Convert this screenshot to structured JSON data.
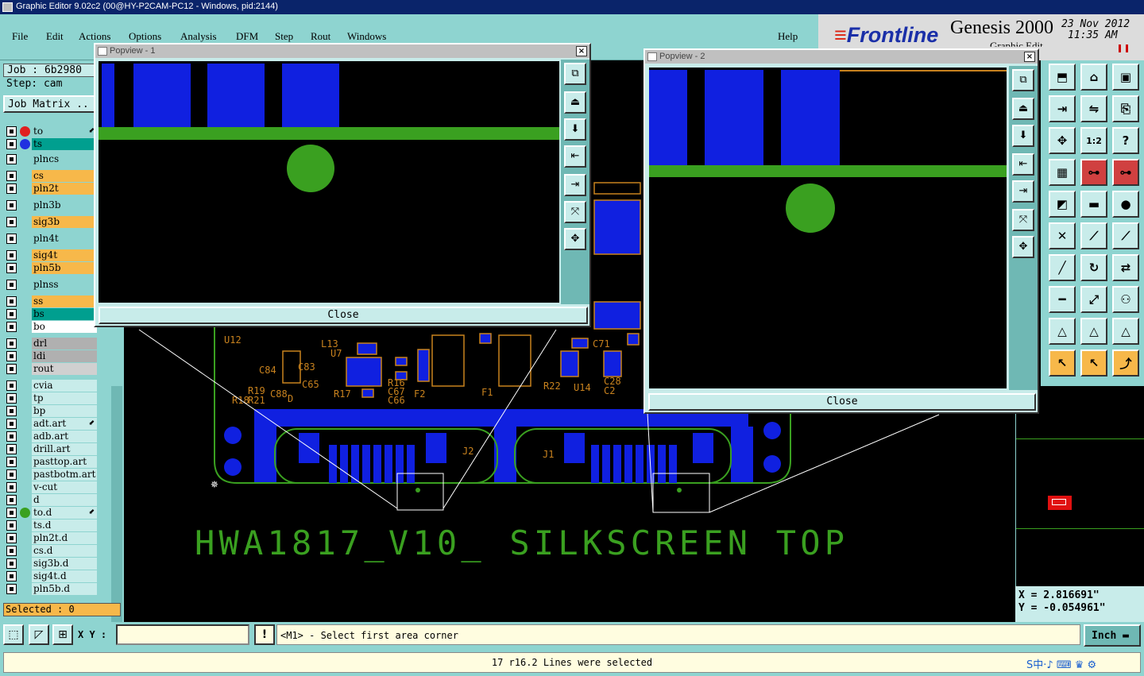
{
  "window": {
    "title": "Graphic Editor 9.02c2 (00@HY-P2CAM-PC12 - Windows, pid:2144)"
  },
  "menu": [
    "File",
    "Edit",
    "Actions",
    "Options",
    "Analysis",
    "DFM",
    "Step",
    "Rout",
    "Windows"
  ],
  "help": "Help",
  "logo": {
    "brand": "Frontline",
    "product": "Genesis 2000",
    "date": "23 Nov 2012",
    "time": "11:35 AM",
    "subtitle": "Graphic Edit"
  },
  "job": {
    "label": "Job : 6b2980",
    "step": "Step: cam",
    "matrix": "Job Matrix .."
  },
  "layers": [
    {
      "name": "to",
      "color": "#8ed4d0",
      "dot": "#e02020",
      "arrow": true
    },
    {
      "name": "ts",
      "color": "#009f8f",
      "dot": "#2030e0",
      "arrow": false
    },
    {
      "name": "plncs",
      "color": "#8ed4d0",
      "dot": "",
      "arrow": false
    },
    {
      "name": "cs",
      "color": "#f7b84a",
      "dot": "",
      "arrow": false
    },
    {
      "name": "pln2t",
      "color": "#f7b84a",
      "dot": "",
      "arrow": false
    },
    {
      "name": "pln3b",
      "color": "#8ed4d0",
      "dot": "",
      "arrow": false
    },
    {
      "name": "sig3b",
      "color": "#f7b84a",
      "dot": "",
      "arrow": false
    },
    {
      "name": "pln4t",
      "color": "#8ed4d0",
      "dot": "",
      "arrow": false
    },
    {
      "name": "sig4t",
      "color": "#f7b84a",
      "dot": "",
      "arrow": false
    },
    {
      "name": "pln5b",
      "color": "#f7b84a",
      "dot": "",
      "arrow": false
    },
    {
      "name": "plnss",
      "color": "#8ed4d0",
      "dot": "",
      "arrow": false
    },
    {
      "name": "ss",
      "color": "#f7b84a",
      "dot": "",
      "arrow": false
    },
    {
      "name": "bs",
      "color": "#009f8f",
      "dot": "",
      "arrow": false
    },
    {
      "name": "bo",
      "color": "#ffffff",
      "dot": "",
      "arrow": false
    },
    {
      "name": "drl",
      "color": "#b0b0b0",
      "dot": "",
      "arrow": false
    },
    {
      "name": "ldi",
      "color": "#b0b0b0",
      "dot": "",
      "arrow": false
    },
    {
      "name": "rout",
      "color": "#d0d0d0",
      "dot": "",
      "arrow": false
    },
    {
      "name": "cvia",
      "color": "#c8ecea",
      "dot": "",
      "arrow": false
    },
    {
      "name": "tp",
      "color": "#c8ecea",
      "dot": "",
      "arrow": false
    },
    {
      "name": "bp",
      "color": "#c8ecea",
      "dot": "",
      "arrow": false
    },
    {
      "name": "adt.art",
      "color": "#c8ecea",
      "dot": "",
      "arrow": true
    },
    {
      "name": "adb.art",
      "color": "#c8ecea",
      "dot": "",
      "arrow": false
    },
    {
      "name": "drill.art",
      "color": "#c8ecea",
      "dot": "",
      "arrow": false
    },
    {
      "name": "pasttop.art",
      "color": "#c8ecea",
      "dot": "",
      "arrow": false
    },
    {
      "name": "pastbotm.art",
      "color": "#c8ecea",
      "dot": "",
      "arrow": false
    },
    {
      "name": "v-cut",
      "color": "#c8ecea",
      "dot": "",
      "arrow": false
    },
    {
      "name": "d",
      "color": "#c8ecea",
      "dot": "",
      "arrow": false
    },
    {
      "name": "to.d",
      "color": "#c8ecea",
      "dot": "#3aa020",
      "arrow": true
    },
    {
      "name": "ts.d",
      "color": "#c8ecea",
      "dot": "",
      "arrow": false
    },
    {
      "name": "pln2t.d",
      "color": "#c8ecea",
      "dot": "",
      "arrow": false
    },
    {
      "name": "cs.d",
      "color": "#c8ecea",
      "dot": "",
      "arrow": false
    },
    {
      "name": "sig3b.d",
      "color": "#c8ecea",
      "dot": "",
      "arrow": false
    },
    {
      "name": "sig4t.d",
      "color": "#c8ecea",
      "dot": "",
      "arrow": false
    },
    {
      "name": "pln5b.d",
      "color": "#c8ecea",
      "dot": "",
      "arrow": false
    }
  ],
  "selected": "Selected : 0",
  "canvas": {
    "silkscreen": "HWA1817_V10_ SILKSCREEN TOP",
    "labels": [
      "U12",
      "L13",
      "U7",
      "R16",
      "C67",
      "C66",
      "F2",
      "F1",
      "R22",
      "U14",
      "C71",
      "C28",
      "C2",
      "R17",
      "C65",
      "C84",
      "C83",
      "R19",
      "C88",
      "R21",
      "R18",
      "J2",
      "J1",
      "D"
    ]
  },
  "popview1": {
    "title": "Popview - 1",
    "close": "Close"
  },
  "popview2": {
    "title": "Popview - 2",
    "close": "Close"
  },
  "coords": {
    "x": "X = 2.816691\"",
    "y": "Y = -0.054961\""
  },
  "xy_label": "X Y :",
  "xy_value": "",
  "prompt": "<M1> - Select first area corner",
  "unit": "Inch",
  "status": "17 r16.2 Lines were selected",
  "right_tools": [
    "move-icon",
    "home-icon",
    "window-icon",
    "import-icon",
    "swap-icon",
    "align-icon",
    "center-icon",
    "ratio-icon",
    "help-icon",
    "grid-icon",
    "snap-icon",
    "snap2-icon",
    "measure-icon",
    "ruler-icon",
    "pad-icon",
    "cross-icon",
    "link-icon",
    "link2-icon",
    "line-icon",
    "rotate-icon",
    "flip-icon",
    "minus-icon",
    "scale-icon",
    "group-icon",
    "triangle-icon",
    "triangle2-icon",
    "triangle3-icon",
    "cursor-icon",
    "cursor2-icon",
    "route-icon"
  ],
  "tray": "S中·♪ ⌨ ♛ ⚙"
}
